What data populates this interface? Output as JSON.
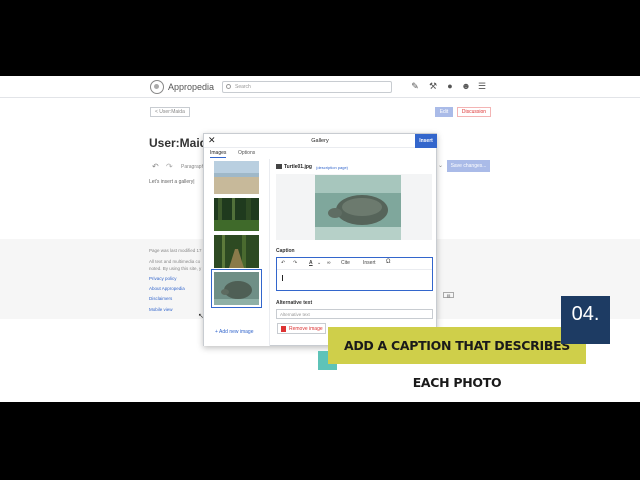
{
  "site": {
    "brand": "Appropedia",
    "search_placeholder": "Search"
  },
  "nav": {
    "back_label": "< User:Maida",
    "edit_label": "Edit",
    "discussion_label": "Discussion"
  },
  "page": {
    "title": "User:Maid",
    "paragraph_label": "Paragraph",
    "save_label": "Save changes...",
    "body_text": "Let's insert a gallery|"
  },
  "footer": {
    "modified": "Page was last modified 17",
    "license": "All text and multimedia co",
    "noted": "noted. By using this site, y",
    "links": [
      "Privacy policy",
      "About Appropedia",
      "Disclaimers",
      "Mobile view"
    ]
  },
  "dialog": {
    "title": "Gallery",
    "insert_label": "Insert",
    "tabs": [
      "Images",
      "Options"
    ],
    "active_tab": "Images",
    "add_image_label": "+ Add new image",
    "file_name": "Turtle01.jpg",
    "description_link": "(description page)",
    "caption_label": "Caption",
    "toolbar": {
      "style": "A",
      "cite": "Cite",
      "insert": "Insert",
      "special": "Ω"
    },
    "alt_text_label": "Alternative text",
    "alt_text_placeholder": "Alternative text",
    "remove_label": "Remove image"
  },
  "overlay": {
    "step_number": "04.",
    "instruction": "ADD A CAPTION THAT DESCRIBES EACH PHOTO",
    "colors": {
      "banner": "#cfcf4a",
      "step_box": "#1d3b63",
      "accent": "#5ec3b8"
    }
  },
  "icons": [
    "search-icon",
    "pencil-icon",
    "wrench-icon",
    "bell-icon",
    "user-icon",
    "menu-icon",
    "close-icon",
    "undo-icon",
    "redo-icon",
    "link-icon",
    "image-icon",
    "trash-icon"
  ]
}
